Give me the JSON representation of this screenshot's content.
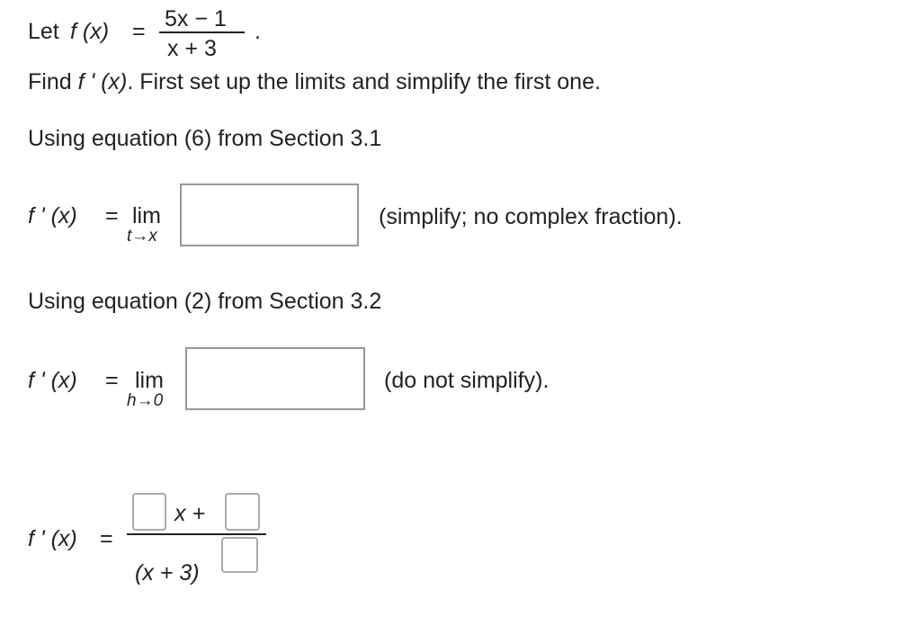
{
  "problem": {
    "let_label": "Let",
    "f_of_x": "f (x)",
    "equals": "=",
    "numerator": "5x − 1",
    "denominator": "x + 3",
    "period": ".",
    "find_prefix": "Find",
    "f_prime": "f ' (x)",
    "find_rest": ". First set up the limits and simplify the first one."
  },
  "section1": {
    "heading": "Using equation (6) from Section 3.1",
    "lhs": "f ' (x)",
    "equals": "=",
    "lim": "lim",
    "lim_sub": "t→x",
    "answer_value": "",
    "hint": "(simplify; no complex fraction)."
  },
  "section2": {
    "heading": "Using equation (2) from Section 3.2",
    "lhs": "f ' (x)",
    "equals": "=",
    "lim": "lim",
    "lim_sub": "h→0",
    "answer_value": "",
    "hint": "(do not simplify)."
  },
  "section3": {
    "lhs": "f ' (x)",
    "equals": "=",
    "x_plus": "x +",
    "denominator_base": "(x + 3)",
    "coef_value": "",
    "const_value": "",
    "exponent_value": ""
  }
}
